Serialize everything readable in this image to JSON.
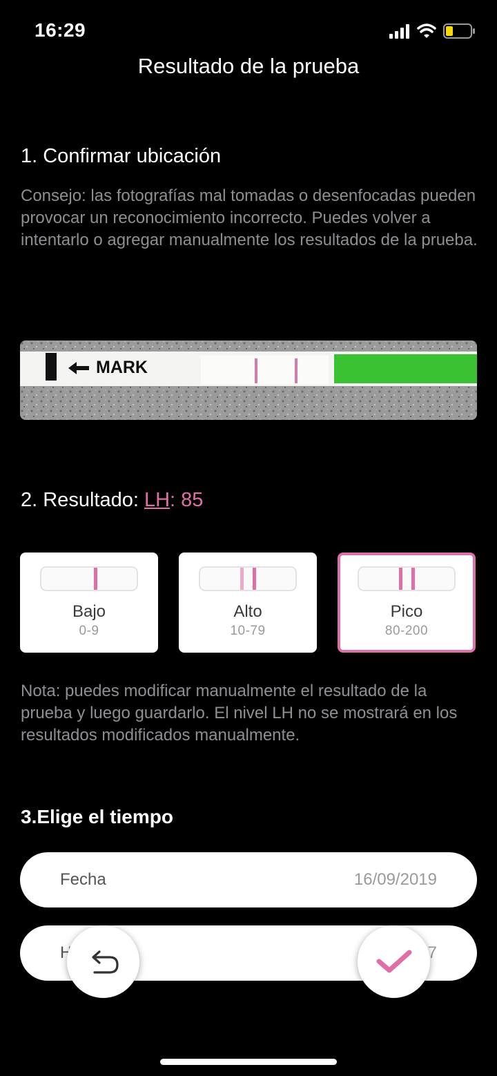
{
  "status_bar": {
    "time": "16:29"
  },
  "nav": {
    "title": "Resultado de la prueba"
  },
  "section1": {
    "title": "1. Confirmar ubicación",
    "tip": "Consejo: las fotografías mal tomadas o desenfocadas pueden provocar un reconocimiento incorrecto. Puedes volver a intentarlo o agregar manualmente los resultados de la prueba.",
    "strip_label": "MARK"
  },
  "section2": {
    "title_prefix": "2. Resultado: ",
    "lh_label": "LH",
    "value_text": ": 85",
    "levels": [
      {
        "label": "Bajo",
        "range": "0-9"
      },
      {
        "label": "Alto",
        "range": "10-79"
      },
      {
        "label": "Pico",
        "range": "80-200"
      }
    ],
    "selected": "Pico",
    "note": "Nota: puedes modificar manualmente el resultado de la prueba y luego guardarlo. El nivel LH no se mostrará en los resultados modificados manualmente."
  },
  "section3": {
    "title": "3.Elige el tiempo",
    "date_label": "Fecha",
    "date_value": "16/09/2019",
    "hour_label": "H",
    "hour_value": "7"
  },
  "actions": {
    "undo_icon": "undo-icon",
    "confirm_icon": "check-icon"
  },
  "colors": {
    "accent": "#e06fa8",
    "background": "#000000"
  }
}
